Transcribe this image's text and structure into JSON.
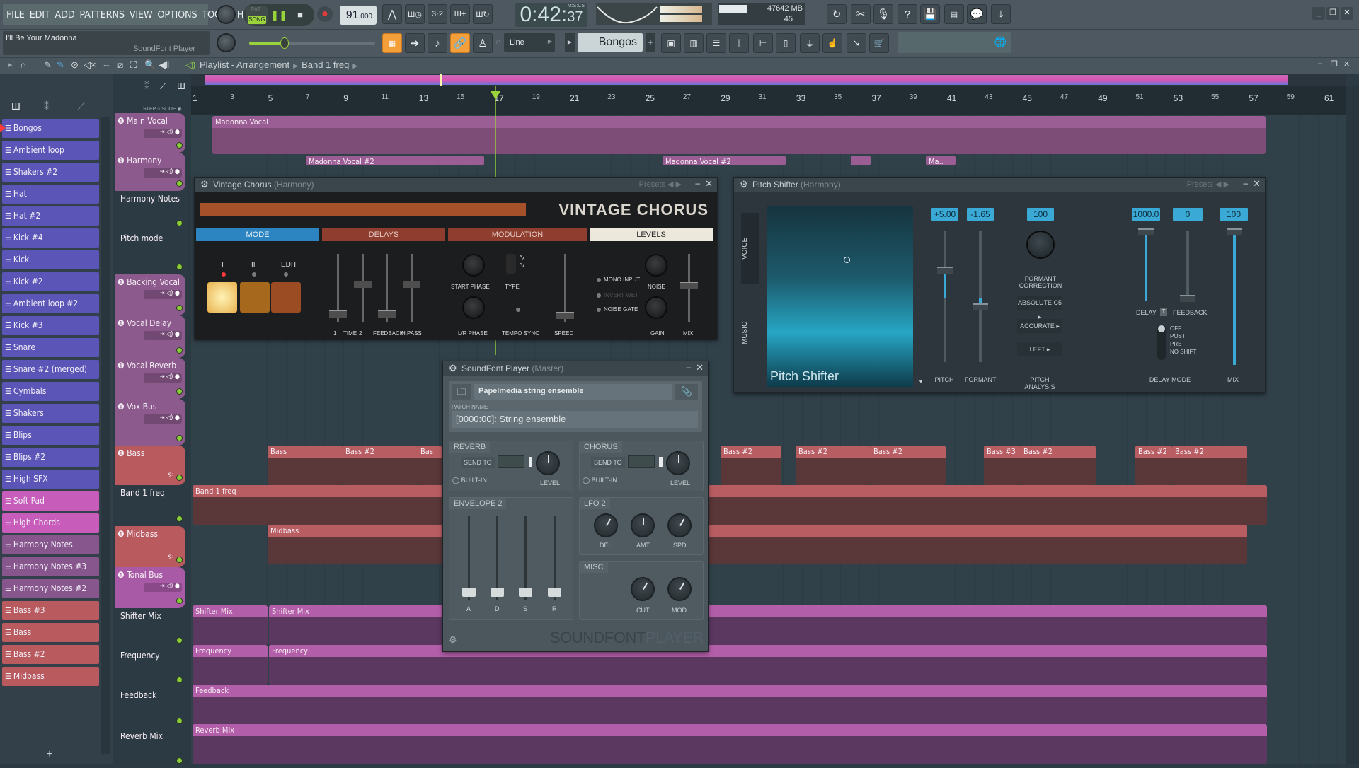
{
  "menu": [
    "FILE",
    "EDIT",
    "ADD",
    "PATTERNS",
    "VIEW",
    "OPTIONS",
    "TOOLS",
    "HELP"
  ],
  "hint": {
    "title": "I'll Be Your Madonna",
    "channel": "SoundFont Player"
  },
  "transport": {
    "pat": "PAT",
    "song": "SONG",
    "mode": "SONG",
    "tempo": "91",
    "tempo_frac": ".000",
    "time": "0:42",
    "time_cs": "37",
    "time_format": "M:S:CS"
  },
  "cpu": {
    "cpu": "47",
    "memory": "642 MB",
    "polyphony": "45"
  },
  "toolbar2": {
    "snap": "Line",
    "pattern": "Bongos"
  },
  "playlist": {
    "breadcrumb": [
      "Playlist - Arrangement",
      "Band 1 freq"
    ],
    "step_label": "STEP",
    "slide_label": "SLIDE",
    "ruler": [
      "1",
      "3",
      "5",
      "7",
      "9",
      "11",
      "13",
      "15",
      "17",
      "19",
      "21",
      "23",
      "25",
      "27",
      "29",
      "31",
      "33",
      "35",
      "37",
      "39",
      "41",
      "43",
      "45",
      "47",
      "49",
      "51",
      "53",
      "55",
      "57",
      "59",
      "61"
    ],
    "patterns": [
      {
        "label": "Bongos",
        "color": "blue",
        "selected": true
      },
      {
        "label": "Ambient loop",
        "color": "blue"
      },
      {
        "label": "Shakers #2",
        "color": "blue"
      },
      {
        "label": "Hat",
        "color": "blue"
      },
      {
        "label": "Hat #2",
        "color": "blue"
      },
      {
        "label": "Kick #4",
        "color": "blue"
      },
      {
        "label": "Kick",
        "color": "blue"
      },
      {
        "label": "Kick #2",
        "color": "blue"
      },
      {
        "label": "Ambient loop #2",
        "color": "blue"
      },
      {
        "label": "Kick #3",
        "color": "blue"
      },
      {
        "label": "Snare",
        "color": "blue"
      },
      {
        "label": "Snare #2  (merged)",
        "color": "blue"
      },
      {
        "label": "Cymbals",
        "color": "blue"
      },
      {
        "label": "Shakers",
        "color": "blue"
      },
      {
        "label": "Blips",
        "color": "blue"
      },
      {
        "label": "Blips #2",
        "color": "blue"
      },
      {
        "label": "High SFX",
        "color": "blue"
      },
      {
        "label": "Soft Pad",
        "color": "pink"
      },
      {
        "label": "High Chords",
        "color": "pink"
      },
      {
        "label": "Harmony Notes",
        "color": "mauve"
      },
      {
        "label": "Harmony Notes #3",
        "color": "mauve"
      },
      {
        "label": "Harmony Notes #2",
        "color": "mauve"
      },
      {
        "label": "Bass #3",
        "color": "red"
      },
      {
        "label": "Bass",
        "color": "red"
      },
      {
        "label": "Bass #2",
        "color": "red"
      },
      {
        "label": "Midbass",
        "color": "red"
      }
    ],
    "tracks": [
      {
        "label": "Main Vocal",
        "type": "bus"
      },
      {
        "label": "Harmony",
        "type": "bus"
      },
      {
        "label": "Harmony Notes",
        "type": "sub"
      },
      {
        "label": "Pitch mode",
        "type": "sub"
      },
      {
        "label": "Backing Vocal",
        "type": "bus"
      },
      {
        "label": "Vocal Delay",
        "type": "bus"
      },
      {
        "label": "Vocal Reverb",
        "type": "bus"
      },
      {
        "label": "Vox Bus",
        "type": "bus"
      },
      {
        "label": "Bass",
        "type": "inst"
      },
      {
        "label": "Band 1 freq",
        "type": "sub"
      },
      {
        "label": "Midbass",
        "type": "inst"
      },
      {
        "label": "Tonal Bus",
        "type": "bus"
      },
      {
        "label": "Shifter Mix",
        "type": "sub"
      },
      {
        "label": "Frequency",
        "type": "sub"
      },
      {
        "label": "Feedback",
        "type": "sub"
      },
      {
        "label": "Reverb Mix",
        "type": "sub"
      }
    ],
    "clips": {
      "madonna_vocal": "Madonna Vocal",
      "madonna_vocal2": "Madonna Vocal #2",
      "madonna_short": "Ma..",
      "bass": "Bass",
      "bass2": "Bass #2",
      "bass3": "Bass #3",
      "bas": "Bas",
      "band1": "Band 1 freq",
      "midbass": "Midbass",
      "shifter": "Shifter Mix",
      "frequency": "Frequency",
      "feedback": "Feedback",
      "reverb": "Reverb Mix"
    }
  },
  "vintage_chorus": {
    "title": "Vintage Chorus",
    "host": "(Harmony)",
    "presets": "Presets",
    "name": "VINTAGE CHORUS",
    "sections": [
      "MODE",
      "DELAYS",
      "MODULATION",
      "LEVELS"
    ],
    "mode_labels": [
      "I",
      "II",
      "EDIT"
    ],
    "delay_labels": [
      "1",
      "TIME",
      "2",
      "FEEDBACK",
      "H.PASS"
    ],
    "mod_labels": [
      "START PHASE",
      "TYPE",
      "L/R PHASE",
      "TEMPO SYNC",
      "SPEED"
    ],
    "level_labels": [
      "MONO INPUT",
      "INVERT WET",
      "NOISE GATE",
      "NOISE",
      "GAIN",
      "MIX"
    ]
  },
  "pitch_shifter": {
    "title": "Pitch Shifter",
    "host": "(Harmony)",
    "presets": "Presets",
    "brand": "Pitch Shifter",
    "tabs": [
      "VOICE",
      "MUSIC"
    ],
    "pitch": "+5.00",
    "formant": "-1.65",
    "formant_correction": "100",
    "delay": "1000.0",
    "feedback": "0",
    "mix": "100",
    "labels": [
      "PITCH",
      "FORMANT",
      "FORMANT CORRECTION",
      "PITCH ANALYSIS",
      "DELAY",
      "FEEDBACK",
      "DELAY MODE",
      "MIX"
    ],
    "analysis_options": [
      "ABSOLUTE C5",
      "ACCURATE",
      "LEFT"
    ],
    "delay_modes": [
      "OFF",
      "POST",
      "PRE",
      "NO SHIFT"
    ],
    "t_button": "T"
  },
  "soundfont": {
    "title": "SoundFont Player",
    "host": "(Master)",
    "file": "Papelmedia string ensemble",
    "patch_label": "PATCH NAME",
    "patch": "[0000:00]: String ensemble",
    "reverb": "REVERB",
    "chorus": "CHORUS",
    "send_to": "SEND TO",
    "built_in": "BUILT-IN",
    "level": "LEVEL",
    "envelope": "ENVELOPE 2",
    "env_labels": [
      "A",
      "D",
      "S",
      "R"
    ],
    "lfo": "LFO 2",
    "lfo_labels": [
      "DEL",
      "AMT",
      "SPD"
    ],
    "misc": "MISC",
    "misc_labels": [
      "CUT",
      "MOD"
    ],
    "brand1": "SOUNDFONT",
    "brand2": "PLAYER"
  }
}
